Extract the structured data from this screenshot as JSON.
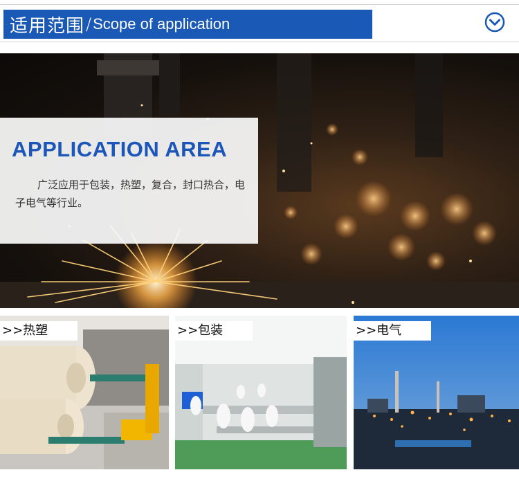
{
  "header": {
    "title_cn": "适用范围",
    "separator": "/",
    "title_en": "Scope of application",
    "toggle_icon": "chevron-down-circle-icon"
  },
  "hero": {
    "heading": "APPLICATION AREA",
    "description": "广泛应用于包装，热塑，复合，封口热合，电子电气等行业。"
  },
  "categories": [
    {
      "label": ">>热塑",
      "image": "paper-rolls-machinery"
    },
    {
      "label": ">>包装",
      "image": "food-packaging-workshop"
    },
    {
      "label": ">>电气",
      "image": "industrial-plant-night"
    }
  ],
  "colors": {
    "accent_blue": "#1a59b5",
    "heading_blue": "#1c56b8"
  }
}
